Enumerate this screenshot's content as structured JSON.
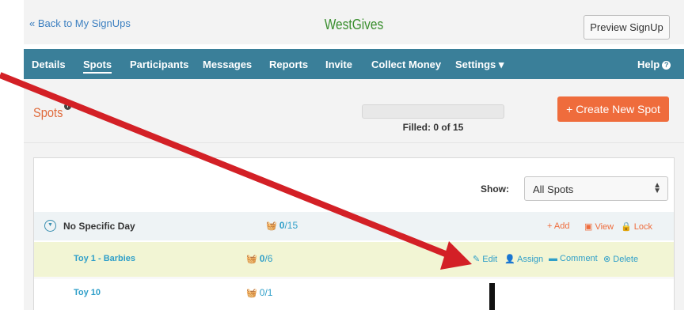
{
  "header": {
    "back_link": "« Back to My SignUps",
    "brand": "WestGives",
    "preview_button": "Preview SignUp"
  },
  "nav": {
    "items": [
      {
        "label": "Details",
        "active": false
      },
      {
        "label": "Spots",
        "active": true
      },
      {
        "label": "Participants",
        "active": false
      },
      {
        "label": "Messages",
        "active": false
      },
      {
        "label": "Reports",
        "active": false
      },
      {
        "label": "Invite",
        "active": false
      },
      {
        "label": "Collect Money",
        "active": false
      },
      {
        "label": "Settings ▾",
        "active": false
      }
    ],
    "help": "Help"
  },
  "spots_header": {
    "title": "Spots",
    "filled_text": "Filled: 0 of 15",
    "filled_fraction": 0,
    "create_button": "+ Create New Spot"
  },
  "filter": {
    "show_label": "Show:",
    "selected": "All Spots"
  },
  "day_group": {
    "label": "No Specific Day",
    "filled": "0",
    "total": "/15",
    "actions": [
      "+ Add",
      "▣ View",
      "🔒 Lock"
    ]
  },
  "spots": [
    {
      "name": "Toy 1 - Barbies",
      "filled": "0",
      "total": "/6",
      "actions": [
        "✎ Edit",
        "👤 Assign",
        "▬ Comment",
        "⊗ Delete"
      ]
    },
    {
      "name": "Toy 10",
      "filled": "0",
      "total": "/1"
    }
  ],
  "colors": {
    "nav_bg": "#3a7f99",
    "brand": "#3a8e2e",
    "accent_orange": "#ef6c3c",
    "link_blue": "#2f9fc9",
    "arrow_red": "#d32026"
  },
  "icons": {
    "info": "info-icon",
    "help": "question-icon",
    "basket": "basket-icon",
    "collapse": "chevron-down-circle-icon",
    "select_caret": "updown-caret-icon"
  }
}
